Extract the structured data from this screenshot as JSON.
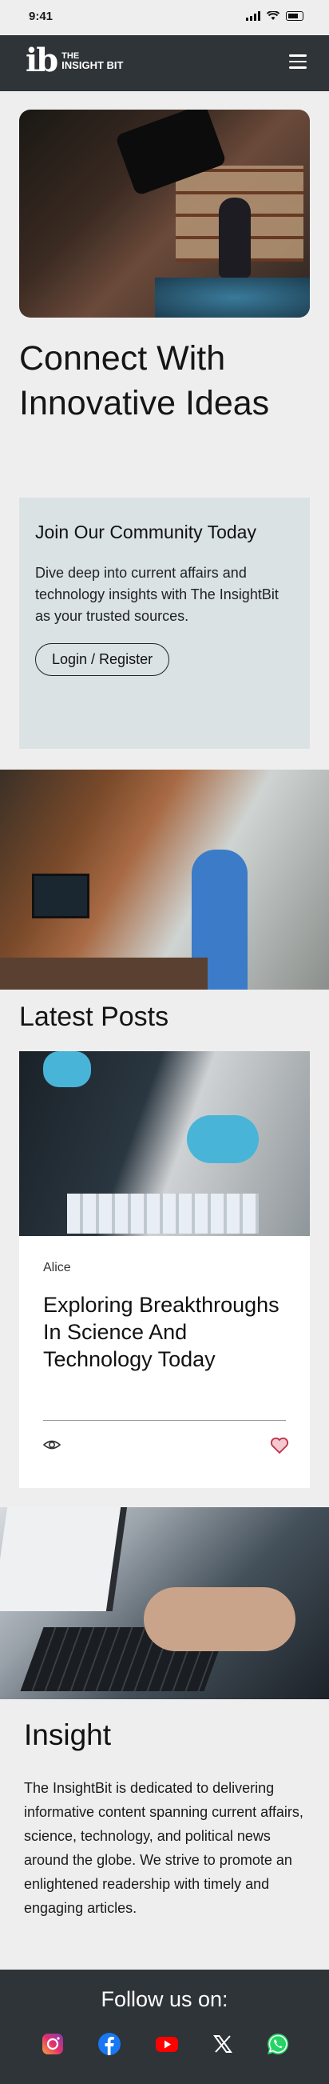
{
  "status_bar": {
    "time": "9:41"
  },
  "header": {
    "logo_mark": "ib",
    "logo_the": "THE",
    "logo_name": "INSIGHT BIT"
  },
  "hero": {
    "headline": "Connect With Innovative Ideas"
  },
  "community": {
    "title": "Join Our Community Today",
    "body": "Dive deep into current affairs and technology insights with The InsightBit as your trusted sources.",
    "button_label": "Login / Register"
  },
  "latest": {
    "heading": "Latest Posts",
    "posts": [
      {
        "author": "Alice",
        "title": "Exploring Breakthroughs In Science And Technology Today"
      }
    ]
  },
  "insight": {
    "heading": "Insight",
    "body": "The InsightBit is dedicated to delivering informative content spanning current affairs, science, technology, and political news around the globe. We strive to promote an enlightened readership with timely and engaging articles."
  },
  "footer": {
    "follow_label": "Follow us on:",
    "social": [
      "instagram-icon",
      "facebook-icon",
      "youtube-icon",
      "x-icon",
      "whatsapp-icon"
    ]
  },
  "colors": {
    "background": "#efeeef",
    "header_bg": "#2e3438",
    "community_bg": "#dae2e4",
    "heart": "#c0304a"
  }
}
